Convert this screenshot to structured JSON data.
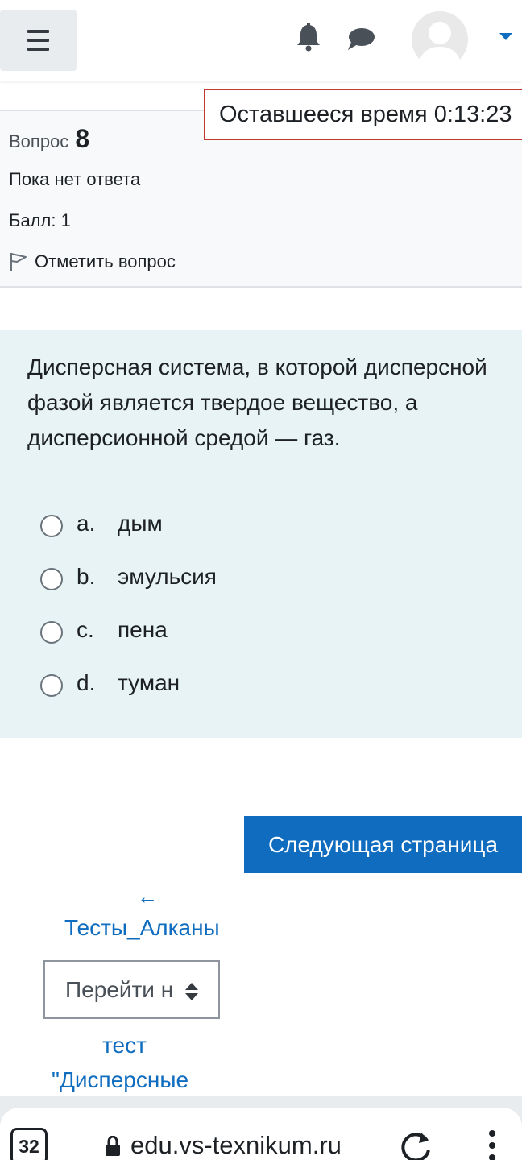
{
  "navbar": {
    "menu_icon": "hamburger-icon",
    "notification_icon": "bell-icon",
    "messages_icon": "chat-icon",
    "user_menu_icon": "caret-down-icon"
  },
  "timer": {
    "label": "Оставшееся время 0:13:23"
  },
  "question_info": {
    "label": "Вопрос",
    "number": "8",
    "state": "Пока нет ответа",
    "grade": "Балл: 1",
    "flag_label": "Отметить вопрос"
  },
  "question": {
    "text": "Дисперсная система, в которой дисперсной фазой является твердое вещество, а дисперсионной средой — газ.",
    "answers": [
      {
        "letter": "a.",
        "text": "дым"
      },
      {
        "letter": "b.",
        "text": "эмульсия"
      },
      {
        "letter": "c.",
        "text": "пена"
      },
      {
        "letter": "d.",
        "text": "туман"
      }
    ]
  },
  "next_button": "Следующая страница",
  "activity_nav": {
    "prev_arrow": "←",
    "prev_link": "Тесты_Алканы",
    "jump_select": "Перейти на...",
    "next_link_line1": "тест",
    "next_link_line2": "\"Дисперсные"
  },
  "browser": {
    "tab_count": "32",
    "url": "edu.vs-texnikum.ru"
  },
  "colors": {
    "primary": "#0f6cbf",
    "timer_border": "#c0392b",
    "content_bg": "#e7f3f5",
    "info_bg": "#f8f9fa"
  }
}
